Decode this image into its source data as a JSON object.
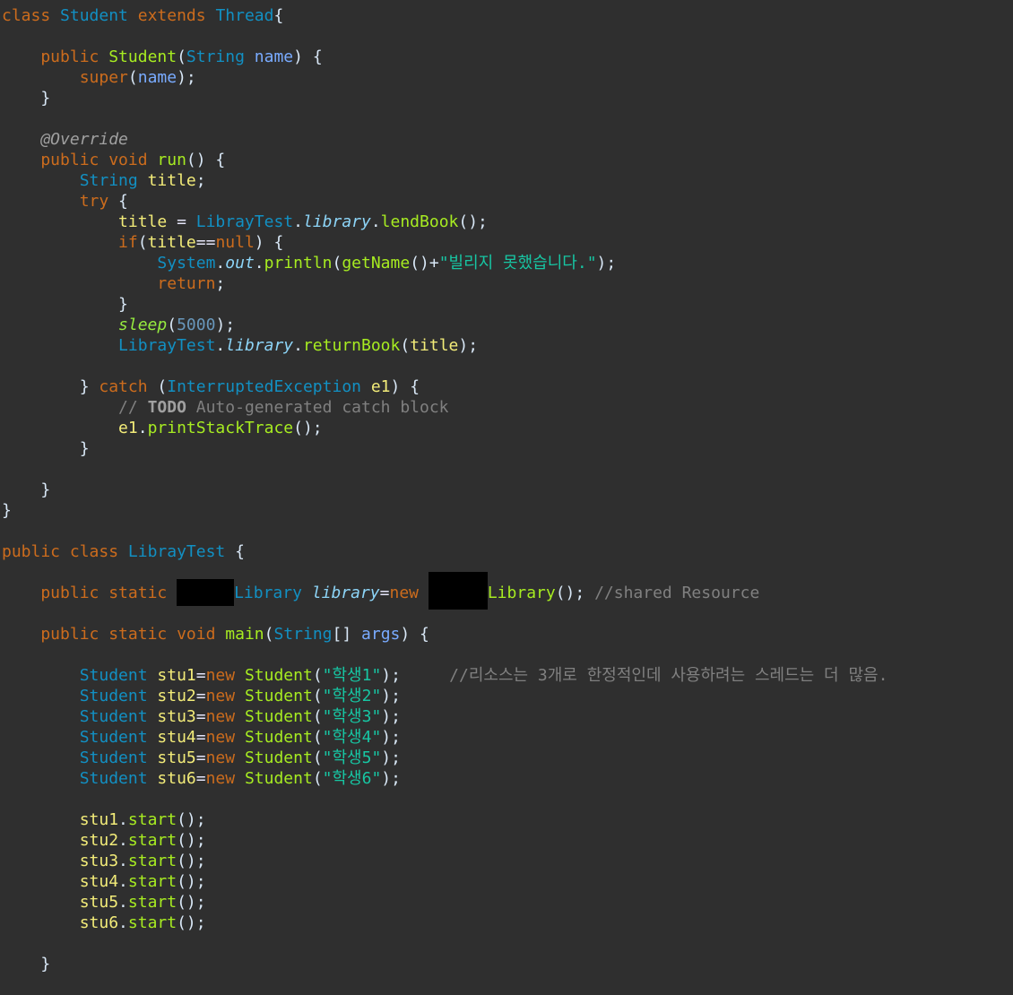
{
  "theme": {
    "background": "#2f2f2f",
    "colors": {
      "keyword": "#cc6c1d",
      "type": "#1290c3",
      "method": "#a7ec21",
      "variable": "#f3ec79",
      "parameter": "#79abff",
      "static_field": "#8dd5f8",
      "string": "#17c6a3",
      "number": "#6897bb",
      "comment": "#808080",
      "default": "#d9e8f7"
    }
  },
  "code_lines": [
    {
      "tokens": [
        {
          "text": "class ",
          "kind": "keyword"
        },
        {
          "text": "Student ",
          "kind": "type"
        },
        {
          "text": "extends ",
          "kind": "keyword"
        },
        {
          "text": "Thread",
          "kind": "type"
        },
        {
          "text": "{",
          "kind": "default"
        }
      ]
    },
    {
      "tokens": []
    },
    {
      "tokens": [
        {
          "text": "    public ",
          "kind": "keyword"
        },
        {
          "text": "Student",
          "kind": "method"
        },
        {
          "text": "(",
          "kind": "default"
        },
        {
          "text": "String ",
          "kind": "type"
        },
        {
          "text": "name",
          "kind": "param"
        },
        {
          "text": ") {",
          "kind": "default"
        }
      ]
    },
    {
      "tokens": [
        {
          "text": "        super",
          "kind": "keyword"
        },
        {
          "text": "(",
          "kind": "default"
        },
        {
          "text": "name",
          "kind": "param"
        },
        {
          "text": ");",
          "kind": "default"
        }
      ]
    },
    {
      "tokens": [
        {
          "text": "    }",
          "kind": "default"
        }
      ]
    },
    {
      "tokens": []
    },
    {
      "tokens": [
        {
          "text": "    @Override",
          "kind": "annot"
        }
      ]
    },
    {
      "tokens": [
        {
          "text": "    public ",
          "kind": "keyword"
        },
        {
          "text": "void ",
          "kind": "keyword"
        },
        {
          "text": "run",
          "kind": "method"
        },
        {
          "text": "() {",
          "kind": "default"
        }
      ]
    },
    {
      "tokens": [
        {
          "text": "        String ",
          "kind": "type"
        },
        {
          "text": "title",
          "kind": "var"
        },
        {
          "text": ";",
          "kind": "default"
        }
      ]
    },
    {
      "tokens": [
        {
          "text": "        try ",
          "kind": "keyword"
        },
        {
          "text": "{",
          "kind": "default"
        }
      ]
    },
    {
      "tokens": [
        {
          "text": "            title",
          "kind": "var"
        },
        {
          "text": " = ",
          "kind": "op"
        },
        {
          "text": "LibrayTest",
          "kind": "type"
        },
        {
          "text": ".",
          "kind": "default"
        },
        {
          "text": "library",
          "kind": "static"
        },
        {
          "text": ".",
          "kind": "default"
        },
        {
          "text": "lendBook",
          "kind": "method"
        },
        {
          "text": "();",
          "kind": "default"
        }
      ]
    },
    {
      "tokens": [
        {
          "text": "            if",
          "kind": "keyword"
        },
        {
          "text": "(",
          "kind": "default"
        },
        {
          "text": "title",
          "kind": "var"
        },
        {
          "text": "==",
          "kind": "op"
        },
        {
          "text": "null",
          "kind": "keyword"
        },
        {
          "text": ") {",
          "kind": "default"
        }
      ]
    },
    {
      "tokens": [
        {
          "text": "                System",
          "kind": "type"
        },
        {
          "text": ".",
          "kind": "default"
        },
        {
          "text": "out",
          "kind": "static"
        },
        {
          "text": ".",
          "kind": "default"
        },
        {
          "text": "println",
          "kind": "method"
        },
        {
          "text": "(",
          "kind": "default"
        },
        {
          "text": "getName",
          "kind": "method"
        },
        {
          "text": "()+",
          "kind": "default"
        },
        {
          "text": "\"빌리지 못했습니다.\"",
          "kind": "string"
        },
        {
          "text": ");",
          "kind": "default"
        }
      ]
    },
    {
      "tokens": [
        {
          "text": "                return",
          "kind": "keyword"
        },
        {
          "text": ";",
          "kind": "default"
        }
      ]
    },
    {
      "tokens": [
        {
          "text": "            }",
          "kind": "default"
        }
      ]
    },
    {
      "tokens": [
        {
          "text": "            sleep",
          "kind": "smethod"
        },
        {
          "text": "(",
          "kind": "default"
        },
        {
          "text": "5000",
          "kind": "number"
        },
        {
          "text": ");",
          "kind": "default"
        }
      ]
    },
    {
      "tokens": [
        {
          "text": "            LibrayTest",
          "kind": "type"
        },
        {
          "text": ".",
          "kind": "default"
        },
        {
          "text": "library",
          "kind": "static"
        },
        {
          "text": ".",
          "kind": "default"
        },
        {
          "text": "returnBook",
          "kind": "method"
        },
        {
          "text": "(",
          "kind": "default"
        },
        {
          "text": "title",
          "kind": "var"
        },
        {
          "text": ");",
          "kind": "default"
        }
      ]
    },
    {
      "tokens": []
    },
    {
      "tokens": [
        {
          "text": "        } ",
          "kind": "default"
        },
        {
          "text": "catch ",
          "kind": "keyword"
        },
        {
          "text": "(",
          "kind": "default"
        },
        {
          "text": "InterruptedException ",
          "kind": "type"
        },
        {
          "text": "e1",
          "kind": "var"
        },
        {
          "text": ") {",
          "kind": "default"
        }
      ]
    },
    {
      "tokens": [
        {
          "text": "            // ",
          "kind": "comment"
        },
        {
          "text": "TODO",
          "kind": "todo"
        },
        {
          "text": " Auto-generated catch block",
          "kind": "comment"
        }
      ]
    },
    {
      "tokens": [
        {
          "text": "            e1",
          "kind": "var"
        },
        {
          "text": ".",
          "kind": "default"
        },
        {
          "text": "printStackTrace",
          "kind": "method"
        },
        {
          "text": "();",
          "kind": "default"
        }
      ]
    },
    {
      "tokens": [
        {
          "text": "        }",
          "kind": "default"
        }
      ]
    },
    {
      "tokens": []
    },
    {
      "tokens": [
        {
          "text": "    }",
          "kind": "default"
        }
      ]
    },
    {
      "tokens": [
        {
          "text": "}",
          "kind": "default"
        }
      ]
    },
    {
      "tokens": []
    },
    {
      "tokens": [
        {
          "text": "public ",
          "kind": "keyword"
        },
        {
          "text": "class ",
          "kind": "keyword"
        },
        {
          "text": "LibrayTest ",
          "kind": "type"
        },
        {
          "text": "{",
          "kind": "default"
        }
      ]
    },
    {
      "tokens": []
    },
    {
      "tokens": [
        {
          "text": "    public ",
          "kind": "keyword"
        },
        {
          "text": "static ",
          "kind": "keyword"
        },
        {
          "text": "",
          "kind": "redacted1"
        },
        {
          "text": "Library ",
          "kind": "type"
        },
        {
          "text": "library",
          "kind": "static"
        },
        {
          "text": "=",
          "kind": "op"
        },
        {
          "text": "new ",
          "kind": "keyword"
        },
        {
          "text": "",
          "kind": "redacted2"
        },
        {
          "text": "Library",
          "kind": "method"
        },
        {
          "text": "(); ",
          "kind": "default"
        },
        {
          "text": "//shared Resource",
          "kind": "comment"
        }
      ]
    },
    {
      "tokens": []
    },
    {
      "tokens": [
        {
          "text": "    public ",
          "kind": "keyword"
        },
        {
          "text": "static ",
          "kind": "keyword"
        },
        {
          "text": "void ",
          "kind": "keyword"
        },
        {
          "text": "main",
          "kind": "method"
        },
        {
          "text": "(",
          "kind": "default"
        },
        {
          "text": "String",
          "kind": "type"
        },
        {
          "text": "[] ",
          "kind": "default"
        },
        {
          "text": "args",
          "kind": "param"
        },
        {
          "text": ") {",
          "kind": "default"
        }
      ]
    },
    {
      "tokens": []
    },
    {
      "tokens": [
        {
          "text": "        Student ",
          "kind": "type"
        },
        {
          "text": "stu1",
          "kind": "var"
        },
        {
          "text": "=",
          "kind": "op"
        },
        {
          "text": "new ",
          "kind": "keyword"
        },
        {
          "text": "Student",
          "kind": "method"
        },
        {
          "text": "(",
          "kind": "default"
        },
        {
          "text": "\"학생1\"",
          "kind": "string"
        },
        {
          "text": ");     ",
          "kind": "default"
        },
        {
          "text": "//리소스는 3개로 한정적인데 사용하려는 스레드는 더 많음.",
          "kind": "comment"
        }
      ]
    },
    {
      "tokens": [
        {
          "text": "        Student ",
          "kind": "type"
        },
        {
          "text": "stu2",
          "kind": "var"
        },
        {
          "text": "=",
          "kind": "op"
        },
        {
          "text": "new ",
          "kind": "keyword"
        },
        {
          "text": "Student",
          "kind": "method"
        },
        {
          "text": "(",
          "kind": "default"
        },
        {
          "text": "\"학생2\"",
          "kind": "string"
        },
        {
          "text": ");",
          "kind": "default"
        }
      ]
    },
    {
      "tokens": [
        {
          "text": "        Student ",
          "kind": "type"
        },
        {
          "text": "stu3",
          "kind": "var"
        },
        {
          "text": "=",
          "kind": "op"
        },
        {
          "text": "new ",
          "kind": "keyword"
        },
        {
          "text": "Student",
          "kind": "method"
        },
        {
          "text": "(",
          "kind": "default"
        },
        {
          "text": "\"학생3\"",
          "kind": "string"
        },
        {
          "text": ");",
          "kind": "default"
        }
      ]
    },
    {
      "tokens": [
        {
          "text": "        Student ",
          "kind": "type"
        },
        {
          "text": "stu4",
          "kind": "var"
        },
        {
          "text": "=",
          "kind": "op"
        },
        {
          "text": "new ",
          "kind": "keyword"
        },
        {
          "text": "Student",
          "kind": "method"
        },
        {
          "text": "(",
          "kind": "default"
        },
        {
          "text": "\"학생4\"",
          "kind": "string"
        },
        {
          "text": ");",
          "kind": "default"
        }
      ]
    },
    {
      "tokens": [
        {
          "text": "        Student ",
          "kind": "type"
        },
        {
          "text": "stu5",
          "kind": "var"
        },
        {
          "text": "=",
          "kind": "op"
        },
        {
          "text": "new ",
          "kind": "keyword"
        },
        {
          "text": "Student",
          "kind": "method"
        },
        {
          "text": "(",
          "kind": "default"
        },
        {
          "text": "\"학생5\"",
          "kind": "string"
        },
        {
          "text": ");",
          "kind": "default"
        }
      ]
    },
    {
      "tokens": [
        {
          "text": "        Student ",
          "kind": "type"
        },
        {
          "text": "stu6",
          "kind": "var"
        },
        {
          "text": "=",
          "kind": "op"
        },
        {
          "text": "new ",
          "kind": "keyword"
        },
        {
          "text": "Student",
          "kind": "method"
        },
        {
          "text": "(",
          "kind": "default"
        },
        {
          "text": "\"학생6\"",
          "kind": "string"
        },
        {
          "text": ");",
          "kind": "default"
        }
      ]
    },
    {
      "tokens": []
    },
    {
      "tokens": [
        {
          "text": "        stu1",
          "kind": "var"
        },
        {
          "text": ".",
          "kind": "default"
        },
        {
          "text": "start",
          "kind": "method"
        },
        {
          "text": "();",
          "kind": "default"
        }
      ]
    },
    {
      "tokens": [
        {
          "text": "        stu2",
          "kind": "var"
        },
        {
          "text": ".",
          "kind": "default"
        },
        {
          "text": "start",
          "kind": "method"
        },
        {
          "text": "();",
          "kind": "default"
        }
      ]
    },
    {
      "tokens": [
        {
          "text": "        stu3",
          "kind": "var"
        },
        {
          "text": ".",
          "kind": "default"
        },
        {
          "text": "start",
          "kind": "method"
        },
        {
          "text": "();",
          "kind": "default"
        }
      ]
    },
    {
      "tokens": [
        {
          "text": "        stu4",
          "kind": "var"
        },
        {
          "text": ".",
          "kind": "default"
        },
        {
          "text": "start",
          "kind": "method"
        },
        {
          "text": "();",
          "kind": "default"
        }
      ]
    },
    {
      "tokens": [
        {
          "text": "        stu5",
          "kind": "var"
        },
        {
          "text": ".",
          "kind": "default"
        },
        {
          "text": "start",
          "kind": "method"
        },
        {
          "text": "();",
          "kind": "default"
        }
      ]
    },
    {
      "tokens": [
        {
          "text": "        stu6",
          "kind": "var"
        },
        {
          "text": ".",
          "kind": "default"
        },
        {
          "text": "start",
          "kind": "method"
        },
        {
          "text": "();",
          "kind": "default"
        }
      ]
    },
    {
      "tokens": []
    },
    {
      "tokens": [
        {
          "text": "    }",
          "kind": "default"
        }
      ]
    }
  ]
}
